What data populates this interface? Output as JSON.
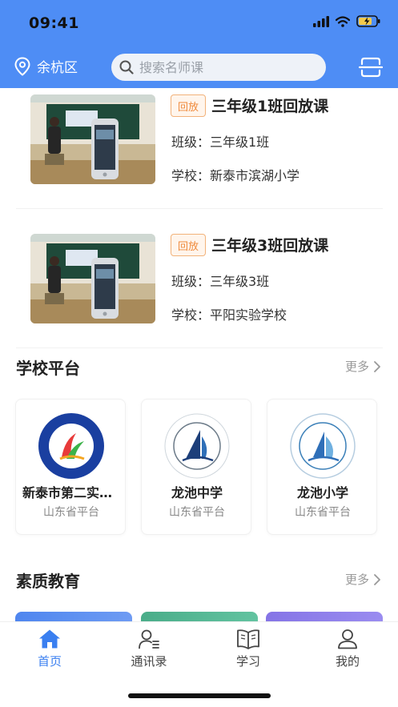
{
  "status_bar": {
    "time": "09:41"
  },
  "header": {
    "location": "余杭区",
    "search_placeholder": "搜索名师课"
  },
  "replay_list": [
    {
      "tag": "回放",
      "title": "三年级1班回放课",
      "class_line": "班级：三年级1班",
      "school_line": "学校：新泰市滨湖小学"
    },
    {
      "tag": "回放",
      "title": "三年级3班回放课",
      "class_line": "班级：三年级3班",
      "school_line": "学校：平阳实验学校"
    }
  ],
  "school_platform": {
    "title": "学校平台",
    "more_label": "更多",
    "schools": [
      {
        "name": "新泰市第二实验小学",
        "platform": "山东省平台"
      },
      {
        "name": "龙池中学",
        "platform": "山东省平台"
      },
      {
        "name": "龙池小学",
        "platform": "山东省平台"
      }
    ]
  },
  "quality_education": {
    "title": "素质教育",
    "more_label": "更多",
    "card_colors": [
      "#5b8ff0",
      "#53b894",
      "#8d7ee8"
    ]
  },
  "tab_bar": {
    "active_color": "#3a7ff0",
    "tabs": [
      {
        "label": "首页",
        "icon": "home-icon",
        "active": true
      },
      {
        "label": "通讯录",
        "icon": "contacts-icon",
        "active": false
      },
      {
        "label": "学习",
        "icon": "book-icon",
        "active": false
      },
      {
        "label": "我的",
        "icon": "profile-icon",
        "active": false
      }
    ]
  },
  "colors": {
    "header_bg": "#4e8df5",
    "tag_orange": "#ef8a3c"
  }
}
